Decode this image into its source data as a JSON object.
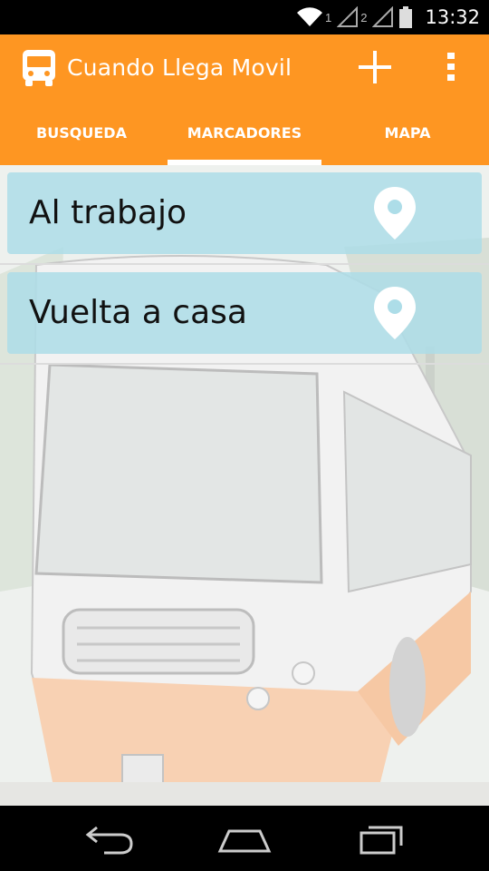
{
  "status_bar": {
    "sim1": "1",
    "sim2": "2",
    "time": "13:32",
    "icons": [
      "wifi-icon",
      "signal-icon",
      "battery-icon"
    ]
  },
  "app_bar": {
    "title": "Cuando Llega Movil",
    "color": "#FE9622",
    "icons": [
      "bus-icon",
      "add-icon",
      "overflow-menu-icon"
    ]
  },
  "tabs": [
    {
      "label": "BUSQUEDA",
      "selected": false
    },
    {
      "label": "MARCADORES",
      "selected": true
    },
    {
      "label": "MAPA",
      "selected": false
    }
  ],
  "bookmarks": [
    {
      "label": "Al trabajo",
      "icon": "location-pin-icon"
    },
    {
      "label": "Vuelta a casa",
      "icon": "location-pin-icon"
    }
  ],
  "card_color": "#ADDDE8",
  "nav_bar": {
    "icons": [
      "back-icon",
      "home-icon",
      "recents-icon"
    ]
  }
}
